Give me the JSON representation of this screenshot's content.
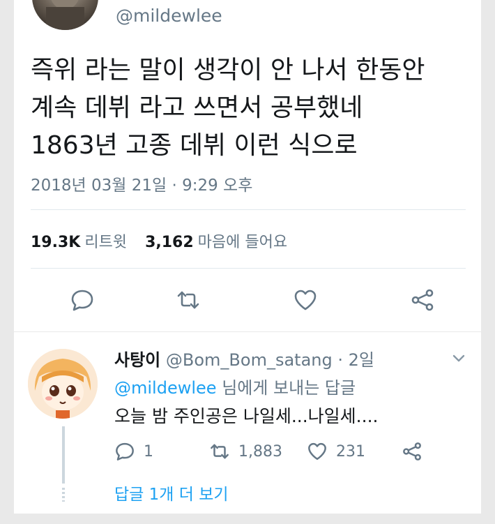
{
  "tweet": {
    "handle": "@mildewlee",
    "text_lines": [
      "즉위 라는 말이 생각이 안 나서 한동안",
      "계속 데뷔 라고 쓰면서 공부했네",
      "1863년 고종 데뷔 이런 식으로"
    ],
    "timestamp": "2018년 03월 21일 · 9:29 오후",
    "retweets_count": "19.3K",
    "retweets_label": "리트윗",
    "likes_count": "3,162",
    "likes_label": "마음에 들어요",
    "actions": [
      "reply-icon",
      "retweet-icon",
      "heart-icon",
      "share-icon"
    ]
  },
  "reply": {
    "name": "사탕이",
    "handle": "@Bom_Bom_satang",
    "time": "· 2일",
    "mention": "@mildewlee",
    "mention_suffix": "님에게 보내는 답글",
    "text": "오늘 밤 주인공은 나일세...나일세....",
    "reply_count": "1",
    "retweet_count": "1,883",
    "like_count": "231",
    "more_replies": "답글 1개 더 보기"
  },
  "colors": {
    "text": "#14171a",
    "secondary": "#657786",
    "link": "#1da1f2",
    "divider": "#e1e8ed",
    "background": "#e9e9e9"
  }
}
